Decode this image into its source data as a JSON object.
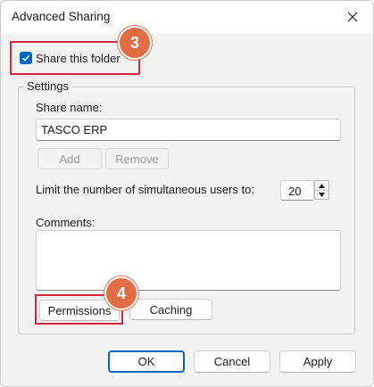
{
  "window": {
    "title": "Advanced Sharing"
  },
  "share": {
    "checkbox_label": "Share this folder",
    "checked": true
  },
  "badges": {
    "step1": "3",
    "step2": "4"
  },
  "settings": {
    "legend": "Settings",
    "share_name_label": "Share name:",
    "share_name_value": "TASCO ERP",
    "add_label": "Add",
    "remove_label": "Remove",
    "limit_label": "Limit the number of simultaneous users to:",
    "limit_value": "20",
    "comments_label": "Comments:",
    "comments_value": "",
    "permissions_label": "Permissions",
    "caching_label": "Caching"
  },
  "footer": {
    "ok_label": "OK",
    "cancel_label": "Cancel",
    "apply_label": "Apply"
  },
  "colors": {
    "accent": "#0067c0",
    "highlight": "#d7263d",
    "badge": "#e26d45"
  },
  "icons": [
    "close-icon",
    "checkmark-icon",
    "spin-up-icon",
    "spin-down-icon"
  ]
}
